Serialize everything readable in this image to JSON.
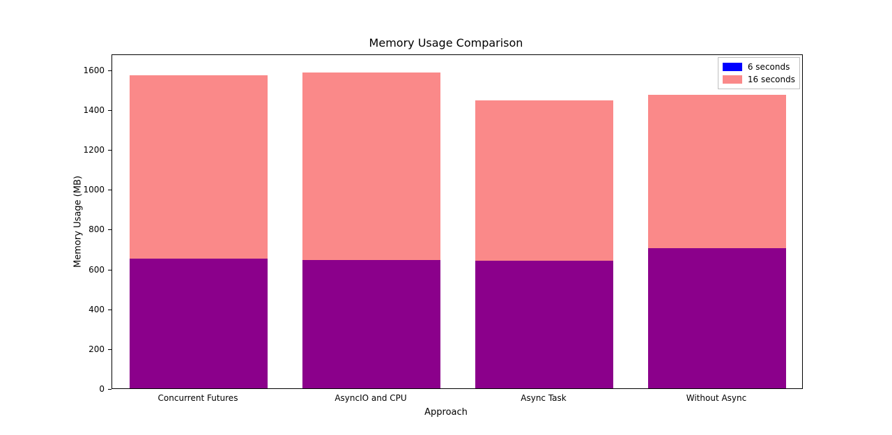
{
  "chart_data": {
    "type": "bar",
    "title": "Memory Usage Comparison",
    "xlabel": "Approach",
    "ylabel": "Memory Usage (MB)",
    "categories": [
      "Concurrent Futures",
      "AsyncIO and CPU",
      "Async Task",
      "Without Async"
    ],
    "series": [
      {
        "name": "6 seconds",
        "color": "#8b008b",
        "values": [
          650,
          645,
          640,
          705
        ]
      },
      {
        "name": "16 seconds",
        "color": "#fa8989",
        "values": [
          920,
          940,
          805,
          770
        ]
      }
    ],
    "ylim": [
      0,
      1680
    ],
    "yticks": [
      0,
      200,
      400,
      600,
      800,
      1000,
      1200,
      1400,
      1600
    ],
    "legend_swatch_colors": [
      "#0000ff",
      "#fa8989"
    ]
  }
}
